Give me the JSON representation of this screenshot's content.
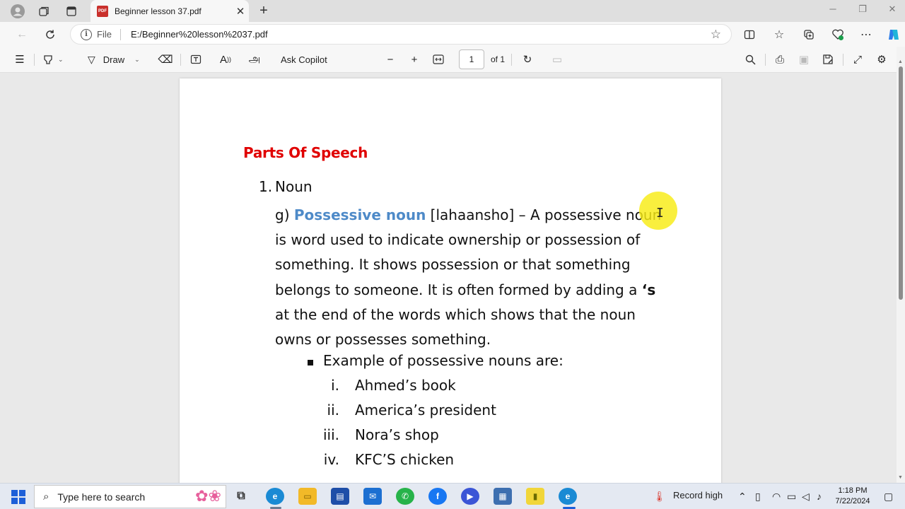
{
  "browser": {
    "tab": {
      "title": "Beginner lesson 37.pdf",
      "icon": "pdf-icon"
    },
    "address": {
      "scheme": "File",
      "url": "E:/Beginner%20lesson%2037.pdf"
    }
  },
  "pdf_toolbar": {
    "draw_label": "Draw",
    "ask_copilot_label": "Ask Copilot",
    "current_page": "1",
    "page_total": "of 1"
  },
  "document": {
    "heading": "Parts Of Speech",
    "list_number": "1.",
    "list_label": "Noun",
    "paragraph": {
      "prefix": "g) ",
      "term": "Possessive noun",
      "text_1": " [lahaansho] – A possessive noun is word used to indicate ownership or possession of something. It shows possession or that something belongs to someone. It is often formed by adding a ",
      "possessive_marker": "‘s",
      "text_2": " at the end of the words which shows that the noun owns or possesses something."
    },
    "bullet_text": "Example of possessive nouns are:",
    "examples": [
      {
        "numeral": "i.",
        "text": "Ahmed’s book"
      },
      {
        "numeral": "ii.",
        "text": "America’s president"
      },
      {
        "numeral": "iii.",
        "text": "Nora’s shop"
      },
      {
        "numeral": "iv.",
        "text": "KFC’S chicken"
      }
    ]
  },
  "taskbar": {
    "search_placeholder": "Type here to search",
    "weather_label": "Record high",
    "time": "1:18 PM",
    "date": "7/22/2024"
  },
  "colors": {
    "heading": "#e00000",
    "term": "#4e8ac8",
    "cursor_highlight": "#f8eb14",
    "windows_blue": "#1d5fd8"
  }
}
